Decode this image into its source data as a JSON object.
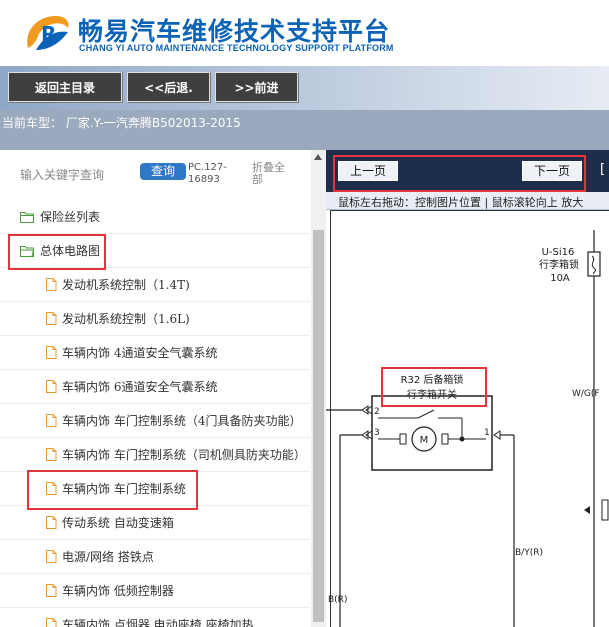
{
  "header": {
    "title": "畅易汽车维修技术支持平台",
    "subtitle": "CHANG YI AUTO MAINTENANCE TECHNOLOGY SUPPORT PLATFORM",
    "brand_colors": {
      "blue": "#0b63b7",
      "orange": "#f29a1f"
    }
  },
  "nav": {
    "home": "返回主目录",
    "back": "<<后退.",
    "forward": ">>前进"
  },
  "vehicle": {
    "text": "当前车型： 厂家.Y-一汽奔腾B502013-2015"
  },
  "search": {
    "label": "输入关键字查询",
    "button": "查询",
    "code": "PC.127-16893",
    "collapse": "折叠全部"
  },
  "tree": {
    "fuse_list": "保险丝列表",
    "wiring": "总体电路图",
    "items": [
      "发动机系统控制（1.4T)",
      "发动机系统控制（1.6L)",
      "车辆内饰 4通道安全气囊系统",
      "车辆内饰 6通道安全气囊系统",
      "车辆内饰 车门控制系统（4门具备防夹功能）",
      "车辆内饰 车门控制系统（司机侧具防夹功能）",
      "车辆内饰 车门控制系统",
      "传动系统 自动变速箱",
      "电源/网络 搭铁点",
      "车辆内饰 低频控制器",
      "车辆内饰 点烟器 电动座椅 座椅加热"
    ]
  },
  "viewer": {
    "prev": "上一页",
    "next": "下一页",
    "cut": "[",
    "hint": "鼠标左右拖动：控制图片位置 | 鼠标滚轮向上 放大"
  },
  "diagram": {
    "fuse_code": "U-Si16",
    "fuse_name": "行李箱锁",
    "fuse_rating": "10A",
    "component_code": "R32 后备箱锁",
    "component_name": "行李箱开关",
    "motor": "M",
    "pin_2": "2",
    "pin_3": "3",
    "pin_1": "1",
    "wire_wgf": "W/G(F",
    "wire_byr": "B/Y(R)",
    "wire_br": "B(R)"
  },
  "icon_names": [
    "logo-icon",
    "folder-icon",
    "file-icon",
    "scroll-up-icon"
  ]
}
